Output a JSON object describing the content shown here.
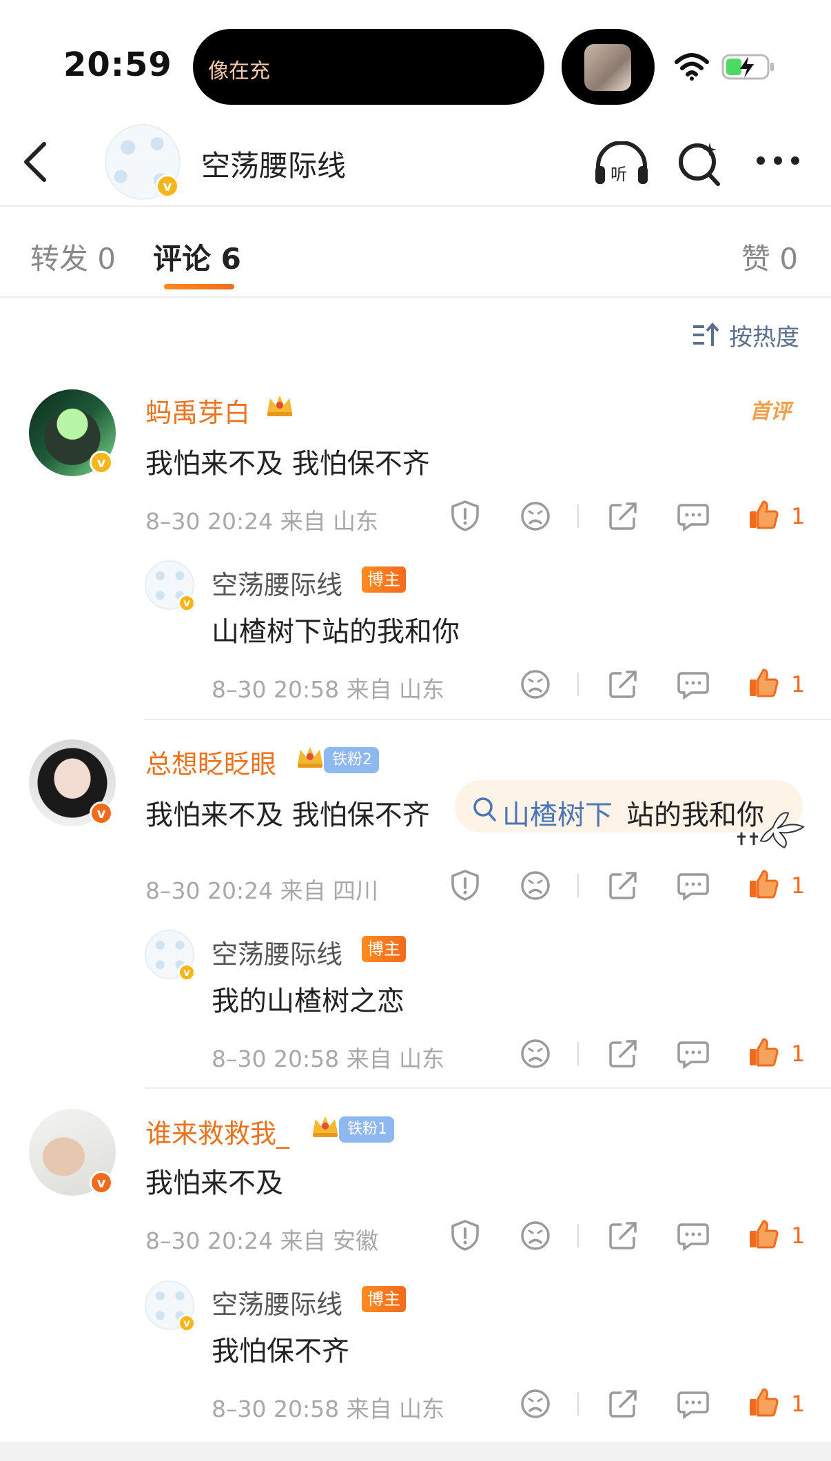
{
  "status": {
    "time": "20:59",
    "island_text": "像在充"
  },
  "nav": {
    "title": "空荡腰际线"
  },
  "tabs": [
    {
      "label": "转发 0"
    },
    {
      "label": "评论 6"
    },
    {
      "label": "赞 0"
    }
  ],
  "sort_label": "按热度",
  "first_comment_tag": "首评",
  "comments": [
    {
      "username": "蚂禹芽白",
      "text": "我怕来不及 我怕保不齐",
      "meta": "8–30 20:24 来自 山东",
      "likes": "1",
      "reply": {
        "username": "空荡腰际线",
        "badge": "博主",
        "text": "山楂树下站的我和你",
        "meta": "8–30 20:58 来自 山东",
        "likes": "1"
      }
    },
    {
      "username": "总想眨眨眼",
      "fan_badge": "铁粉2",
      "text_prefix": "我怕来不及 我怕保不齐",
      "search_link": "山楂树下",
      "text_suffix": "站的我和你",
      "meta": "8–30 20:24 来自 四川",
      "likes": "1",
      "reply": {
        "username": "空荡腰际线",
        "badge": "博主",
        "text": "我的山楂树之恋",
        "meta": "8–30 20:58 来自 山东",
        "likes": "1"
      }
    },
    {
      "username": "谁来救救我_",
      "fan_badge": "铁粉1",
      "text": "我怕来不及",
      "meta": "8–30 20:24 来自 安徽",
      "likes": "1",
      "reply": {
        "username": "空荡腰际线",
        "badge": "博主",
        "text": "我怕保不齐",
        "meta": "8–30 20:58 来自 山东",
        "likes": "1"
      }
    }
  ]
}
